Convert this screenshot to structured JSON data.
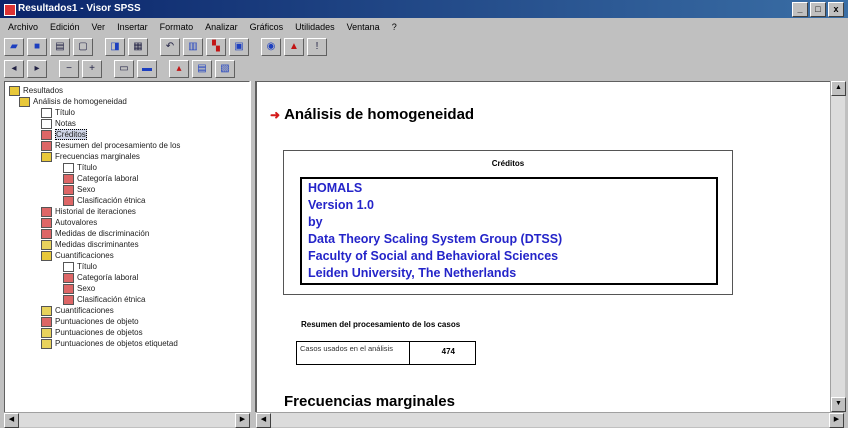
{
  "window": {
    "title": "Resultados1 - Visor SPSS",
    "min": "_",
    "max": "□",
    "close": "x"
  },
  "menu": [
    "Archivo",
    "Edición",
    "Ver",
    "Insertar",
    "Formato",
    "Analizar",
    "Gráficos",
    "Utilidades",
    "Ventana",
    "?"
  ],
  "tree": [
    {
      "label": "Resultados",
      "icon": "folder-icon"
    },
    {
      "label": "Análisis de homogeneidad",
      "icon": "folder-icon"
    },
    {
      "label": "Título",
      "icon": "title-icon"
    },
    {
      "label": "Notas",
      "icon": "notes-icon"
    },
    {
      "label": "Créditos",
      "icon": "doc-icon"
    },
    {
      "label": "Resumen del procesamiento de los",
      "icon": "doc-icon"
    },
    {
      "label": "Frecuencias marginales",
      "icon": "folder-icon"
    },
    {
      "label": "Título",
      "icon": "title-icon"
    },
    {
      "label": "Categoría laboral",
      "icon": "doc-icon"
    },
    {
      "label": "Sexo",
      "icon": "doc-icon"
    },
    {
      "label": "Clasificación étnica",
      "icon": "doc-icon"
    },
    {
      "label": "Historial de iteraciones",
      "icon": "doc-icon"
    },
    {
      "label": "Autovalores",
      "icon": "doc-icon"
    },
    {
      "label": "Medidas de discriminación",
      "icon": "doc-icon"
    },
    {
      "label": "Medidas discriminantes",
      "icon": "chart-icon"
    },
    {
      "label": "Cuantificaciones",
      "icon": "folder-icon"
    },
    {
      "label": "Título",
      "icon": "title-icon"
    },
    {
      "label": "Categoría laboral",
      "icon": "doc-icon"
    },
    {
      "label": "Sexo",
      "icon": "doc-icon"
    },
    {
      "label": "Clasificación étnica",
      "icon": "doc-icon"
    },
    {
      "label": "Cuantificaciones",
      "icon": "chart-icon"
    },
    {
      "label": "Puntuaciones de objeto",
      "icon": "doc-icon"
    },
    {
      "label": "Puntuaciones de objetos",
      "icon": "chart-icon"
    },
    {
      "label": "Puntuaciones de objetos etiquetad",
      "icon": "chart-icon"
    }
  ],
  "content": {
    "heading": "Análisis de homogeneidad",
    "credits_title": "Créditos",
    "credits_lines": [
      "HOMALS",
      "Version 1.0",
      "by",
      "Data Theory Scaling System Group (DTSS)",
      "Faculty of Social and Behavioral Sciences",
      "Leiden University, The Netherlands"
    ],
    "summary_title": "Resumen del procesamiento de los casos",
    "summary_label": "Casos usados en el análisis",
    "summary_value": "474",
    "heading2": "Frecuencias marginales"
  },
  "colors": {
    "title_bar": "#0a246a",
    "credits_text": "#2424c9",
    "arrow": "#d41a1a"
  }
}
